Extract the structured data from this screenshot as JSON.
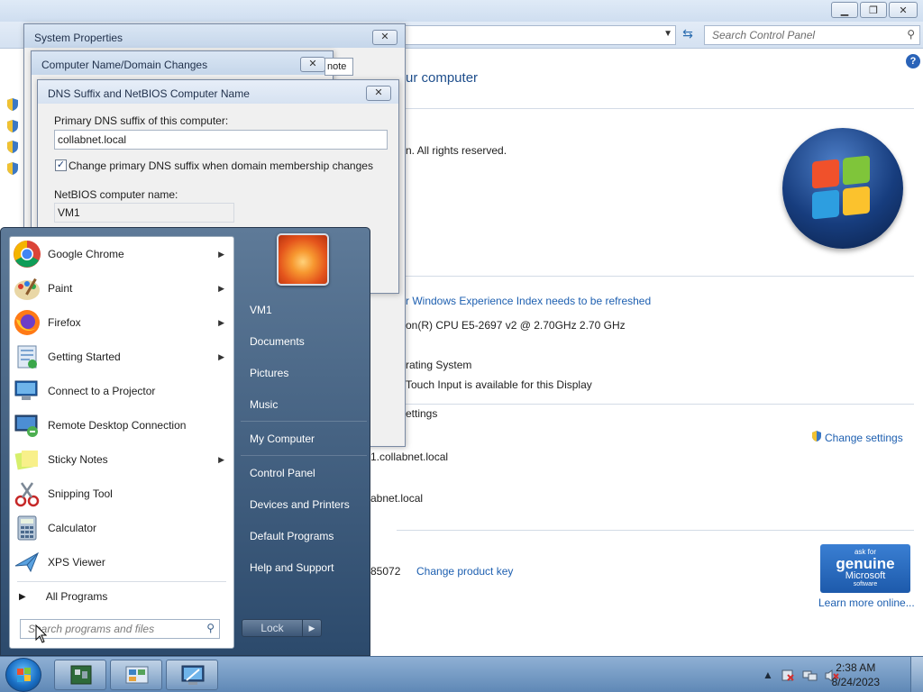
{
  "control_panel": {
    "search_placeholder": "Search Control Panel",
    "heading": "ur computer",
    "copyright": "n.  All rights reserved.",
    "wei_link": "r Windows Experience Index needs to be refreshed",
    "cpu": "on(R) CPU E5-2697 v2 @ 2.70GHz   2.70 GHz",
    "os_type": "rating System",
    "pen_touch": "Touch Input is available for this Display",
    "section_settings": "ettings",
    "change_settings": "Change settings",
    "full_name": "1.collabnet.local",
    "domain": "abnet.local",
    "product_id": "85072",
    "change_product_key": "Change product key",
    "genuine_ask": "ask for",
    "genuine_word": "genuine",
    "genuine_brand": "Microsoft",
    "genuine_software": "software",
    "learn_more": "Learn more online..."
  },
  "dialogs": {
    "system_properties_title": "System Properties",
    "computer_name_title": "Computer Name/Domain Changes",
    "remote_tab": "note",
    "dns_title": "DNS Suffix and NetBIOS Computer Name",
    "primary_dns_label": "Primary DNS suffix of this computer:",
    "primary_dns_value": "collabnet.local",
    "change_suffix_label": "Change primary DNS suffix when domain membership changes",
    "change_suffix_checked": true,
    "netbios_label": "NetBIOS computer name:",
    "netbios_value": "VM1"
  },
  "start_menu": {
    "programs": [
      {
        "label": "Google Chrome",
        "icon": "chrome-icon",
        "submenu": true
      },
      {
        "label": "Paint",
        "icon": "paint-icon",
        "submenu": true
      },
      {
        "label": "Firefox",
        "icon": "firefox-icon",
        "submenu": true
      },
      {
        "label": "Getting Started",
        "icon": "getting-started-icon",
        "submenu": true
      },
      {
        "label": "Connect to a Projector",
        "icon": "projector-icon",
        "submenu": false
      },
      {
        "label": "Remote Desktop Connection",
        "icon": "remote-desktop-icon",
        "submenu": false
      },
      {
        "label": "Sticky Notes",
        "icon": "sticky-notes-icon",
        "submenu": true
      },
      {
        "label": "Snipping Tool",
        "icon": "snipping-tool-icon",
        "submenu": false
      },
      {
        "label": "Calculator",
        "icon": "calculator-icon",
        "submenu": false
      },
      {
        "label": "XPS Viewer",
        "icon": "xps-viewer-icon",
        "submenu": false
      }
    ],
    "all_programs": "All Programs",
    "search_placeholder": "Search programs and files",
    "right_items": {
      "user": "VM1",
      "documents": "Documents",
      "pictures": "Pictures",
      "music": "Music",
      "computer": "My Computer",
      "control_panel": "Control Panel",
      "devices": "Devices and Printers",
      "default_programs": "Default Programs",
      "help": "Help and Support"
    },
    "lock": "Lock"
  },
  "taskbar": {
    "time": "2:38 AM",
    "date": "8/24/2023"
  }
}
